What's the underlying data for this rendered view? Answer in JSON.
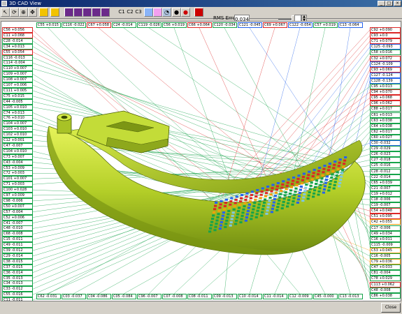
{
  "window": {
    "title": "3D CAD View",
    "controls": [
      "_",
      "□",
      "×"
    ]
  },
  "toolbar": {
    "tools": [
      "arrow-pointer",
      "rotate",
      "zoom",
      "pan",
      "open-folder",
      "view-box-1",
      "view-box-2",
      "view-box-3",
      "view-box-4",
      "view-box-5",
      "view-box-6"
    ],
    "camera_labels": [
      "C1",
      "C2",
      "C3"
    ],
    "rms_label": "RMS Error",
    "rms_value": "0.034"
  },
  "accent_colors": {
    "green": "#16a34a",
    "red": "#dc2626",
    "blue": "#2563eb",
    "orange": "#f59e0b",
    "part": "#b6d12e"
  },
  "top_labels": [
    {
      "text": "C55 +0.015",
      "c": "g"
    },
    {
      "text": "C116 -0.022",
      "c": "g"
    },
    {
      "text": "C67 +0.058",
      "c": "r"
    },
    {
      "text": "C24 -0.014",
      "c": "g"
    },
    {
      "text": "C119 -0.026",
      "c": "g"
    },
    {
      "text": "C56 +0.019",
      "c": "g"
    },
    {
      "text": "C66 +0.064",
      "c": "r"
    },
    {
      "text": "C120 -0.034",
      "c": "g"
    },
    {
      "text": "C121 -0.045",
      "c": "b"
    },
    {
      "text": "C69 +0.067",
      "c": "r"
    },
    {
      "text": "C122 -0.054",
      "c": "b"
    },
    {
      "text": "C57 +0.019",
      "c": "g"
    },
    {
      "text": "C13 -0.064",
      "c": "b"
    }
  ],
  "left_labels": [
    {
      "text": "C56 +0.056",
      "c": "r"
    },
    {
      "text": "C11 +0.068",
      "c": "r"
    },
    {
      "text": "C28 -0.014",
      "c": "g"
    },
    {
      "text": "C34 +0.013",
      "c": "g"
    },
    {
      "text": "C55 +0.054",
      "c": "r"
    },
    {
      "text": "C116 -0.013",
      "c": "g"
    },
    {
      "text": "C114 -0.004",
      "c": "g"
    },
    {
      "text": "C110 +0.007",
      "c": "g"
    },
    {
      "text": "C109 +0.007",
      "c": "g"
    },
    {
      "text": "C108 +0.007",
      "c": "g"
    },
    {
      "text": "C107 +0.006",
      "c": "g"
    },
    {
      "text": "C111 +0.005",
      "c": "g"
    },
    {
      "text": "C75 +0.015",
      "c": "g"
    },
    {
      "text": "C44 -0.005",
      "c": "g"
    },
    {
      "text": "C105 +0.010",
      "c": "g"
    },
    {
      "text": "C74 +0.013",
      "c": "g"
    },
    {
      "text": "C76 +0.010",
      "c": "g"
    },
    {
      "text": "C104 +0.007",
      "c": "g"
    },
    {
      "text": "C103 +0.010",
      "c": "g"
    },
    {
      "text": "C102 +0.010",
      "c": "g"
    },
    {
      "text": "C12 +0.001",
      "c": "g"
    },
    {
      "text": "C47 -0.007",
      "c": "g"
    },
    {
      "text": "C104 +0.010",
      "c": "g"
    },
    {
      "text": "C73 +0.007",
      "c": "g"
    },
    {
      "text": "C43 -0.004",
      "c": "g"
    },
    {
      "text": "C53 +0.009",
      "c": "g"
    },
    {
      "text": "C72 +0.003",
      "c": "g"
    },
    {
      "text": "C101 +0.007",
      "c": "g"
    },
    {
      "text": "C71 +0.003",
      "c": "g"
    },
    {
      "text": "C100 +0.028",
      "c": "g"
    },
    {
      "text": "C97 +0.009",
      "c": "g"
    },
    {
      "text": "C98 -0.006",
      "c": "g"
    },
    {
      "text": "C50 +0.007",
      "c": "g"
    },
    {
      "text": "C57 -0.004",
      "c": "g"
    },
    {
      "text": "C52 +0.006",
      "c": "g"
    },
    {
      "text": "C41 -0.007",
      "c": "g"
    },
    {
      "text": "C48 -0.010",
      "c": "g"
    },
    {
      "text": "C68 -0.008",
      "c": "g"
    },
    {
      "text": "C15 -0.011",
      "c": "g"
    },
    {
      "text": "C49 -0.011",
      "c": "g"
    },
    {
      "text": "C39 -0.012",
      "c": "g"
    },
    {
      "text": "C29 -0.014",
      "c": "g"
    },
    {
      "text": "C38 -0.015",
      "c": "g"
    },
    {
      "text": "C37 -0.015",
      "c": "g"
    },
    {
      "text": "C36 -0.014",
      "c": "g"
    },
    {
      "text": "C35 -0.013",
      "c": "g"
    },
    {
      "text": "C34 -0.013",
      "c": "g"
    },
    {
      "text": "C33 -0.012",
      "c": "g"
    },
    {
      "text": "C55 -0.016",
      "c": "g"
    },
    {
      "text": "C11 -0.011",
      "c": "g"
    }
  ],
  "right_labels": [
    {
      "text": "C92 +0.090",
      "c": "r"
    },
    {
      "text": "C93 +0.0",
      "c": "r"
    },
    {
      "text": "C71 +0.079",
      "c": "r"
    },
    {
      "text": "C125 -0.093",
      "c": "b"
    },
    {
      "text": "C58 +0.016",
      "c": "g"
    },
    {
      "text": "C32 +0.072",
      "c": "r"
    },
    {
      "text": "C124 -0.109",
      "c": "b"
    },
    {
      "text": "C93 +0.069",
      "c": "r"
    },
    {
      "text": "C127 -0.124",
      "c": "b"
    },
    {
      "text": "C128 -0.139",
      "c": "b"
    },
    {
      "text": "C95 +0.013",
      "c": "g"
    },
    {
      "text": "C94 +0.070",
      "c": "r"
    },
    {
      "text": "C95 +0.068",
      "c": "r"
    },
    {
      "text": "C96 +0.062",
      "c": "r"
    },
    {
      "text": "C88 +0.017",
      "c": "g"
    },
    {
      "text": "C61 +0.013",
      "c": "g"
    },
    {
      "text": "C63 +0.038",
      "c": "g"
    },
    {
      "text": "C64 +0.038",
      "c": "g"
    },
    {
      "text": "C62 +0.017",
      "c": "g"
    },
    {
      "text": "C60 +0.027",
      "c": "g"
    },
    {
      "text": "C30 -0.032",
      "c": "b"
    },
    {
      "text": "C29 -0.029",
      "c": "g"
    },
    {
      "text": "C26 -0.023",
      "c": "g"
    },
    {
      "text": "C27 -0.018",
      "c": "g"
    },
    {
      "text": "C25 -0.016",
      "c": "g"
    },
    {
      "text": "C28 -0.012",
      "c": "g"
    },
    {
      "text": "C22 -0.014",
      "c": "g"
    },
    {
      "text": "C65 +0.039",
      "c": "g"
    },
    {
      "text": "C21 -0.007",
      "c": "g"
    },
    {
      "text": "C19 +0.012",
      "c": "g"
    },
    {
      "text": "C18 -0.006",
      "c": "g"
    },
    {
      "text": "C19 -0.007",
      "c": "g"
    },
    {
      "text": "C54 +0.048",
      "c": "r"
    },
    {
      "text": "C51 +0.095",
      "c": "r"
    },
    {
      "text": "C42 +0.055",
      "c": "o"
    },
    {
      "text": "C17 -0.006",
      "c": "g"
    },
    {
      "text": "C49 +0.034",
      "c": "g"
    },
    {
      "text": "C16 +0.011",
      "c": "g"
    },
    {
      "text": "C115 -0.009",
      "c": "g"
    },
    {
      "text": "C53 +0.045",
      "c": "o"
    },
    {
      "text": "C16 -0.005",
      "c": "g"
    },
    {
      "text": "C79 +0.036",
      "c": "o"
    },
    {
      "text": "C47 +0.033",
      "c": "g"
    },
    {
      "text": "C81 -0.004",
      "c": "g"
    },
    {
      "text": "C78 +0.029",
      "c": "g"
    },
    {
      "text": "C113 +0.062",
      "c": "r"
    },
    {
      "text": "C48 -0.008",
      "c": "g"
    },
    {
      "text": "C86 +0.038",
      "c": "g"
    }
  ],
  "bottom_labels": [
    {
      "text": "C62 -0.031",
      "c": "g"
    },
    {
      "text": "C03 -0.037",
      "c": "g"
    },
    {
      "text": "C04 -0.086",
      "c": "g"
    },
    {
      "text": "C05 -0.084",
      "c": "g"
    },
    {
      "text": "C96 -0.007",
      "c": "g"
    },
    {
      "text": "C07 -0.008",
      "c": "g"
    },
    {
      "text": "C08 -0.011",
      "c": "g"
    },
    {
      "text": "C09 -0.013",
      "c": "g"
    },
    {
      "text": "C10 -0.014",
      "c": "g"
    },
    {
      "text": "C11 -0.014",
      "c": "g"
    },
    {
      "text": "C12 -0.009",
      "c": "g"
    },
    {
      "text": "C45 -0.000",
      "c": "g"
    },
    {
      "text": "C13 -0.013",
      "c": "g"
    }
  ],
  "close_label": "Close"
}
